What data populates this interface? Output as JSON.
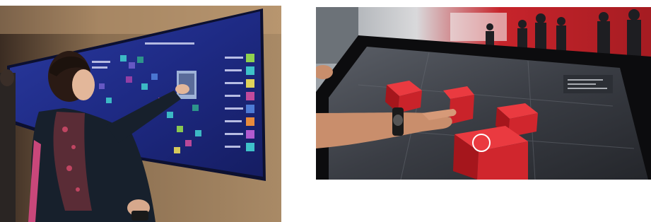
{
  "images": [
    {
      "label": "photo-interactive-wall-display",
      "colors": {
        "wall": "#6f5a44",
        "screen": "#1f2a7a",
        "accent": "#3ec1c9",
        "jacket": "#17202c"
      }
    },
    {
      "label": "photo-touch-table-display",
      "colors": {
        "frame": "#0c0c0e",
        "screen": "#3a3d44",
        "cube": "#d8232a",
        "background": "#c7242b"
      }
    }
  ]
}
